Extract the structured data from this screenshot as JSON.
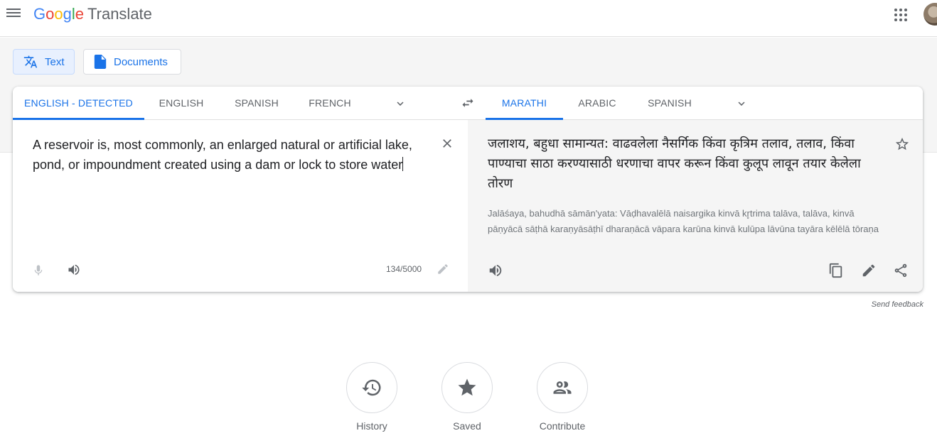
{
  "header": {
    "logo_letters": [
      "G",
      "o",
      "o",
      "g",
      "l",
      "e"
    ],
    "product_name": "Translate"
  },
  "modes": {
    "text_label": "Text",
    "documents_label": "Documents"
  },
  "source": {
    "tabs": [
      "ENGLISH - DETECTED",
      "ENGLISH",
      "SPANISH",
      "FRENCH"
    ],
    "active_tab": "ENGLISH - DETECTED",
    "text": "A reservoir is, most commonly, an enlarged natural or artificial lake, pond, or impoundment created using a dam or lock to store water",
    "char_count": "134/5000"
  },
  "target": {
    "tabs": [
      "MARATHI",
      "ARABIC",
      "SPANISH"
    ],
    "active_tab": "MARATHI",
    "text": "जलाशय, बहुधा सामान्यत: वाढवलेला नैसर्गिक किंवा कृत्रिम तलाव, तलाव, किंवा पाण्याचा साठा करण्यासाठी धरणाचा वापर करून किंवा कुलूप लावून तयार केलेला तोरण",
    "transliteration": "Jalāśaya, bahudhā sāmān'yata: Vāḍhavalēlā naisargika kinvā kr̥trima talāva, talāva, kinvā pāṇyācā sāṭhā karaṇyāsāṭhī dharaṇācā vāpara karūna kinvā kulūpa lāvūna tayāra kēlēlā tōraṇa"
  },
  "feedback_label": "Send feedback",
  "bottom": {
    "history_label": "History",
    "saved_label": "Saved",
    "contribute_label": "Contribute"
  },
  "colors": {
    "accent": "#1a73e8",
    "icon_gray": "#5f6368",
    "target_bg": "#f5f5f5"
  },
  "icons": [
    "menu-icon",
    "apps-icon",
    "translate-icon",
    "document-icon",
    "chevron-down-icon",
    "swap-icon",
    "close-icon",
    "mic-icon",
    "speaker-icon",
    "pencil-icon",
    "star-icon",
    "copy-icon",
    "share-icon",
    "history-icon",
    "contribute-icon"
  ]
}
